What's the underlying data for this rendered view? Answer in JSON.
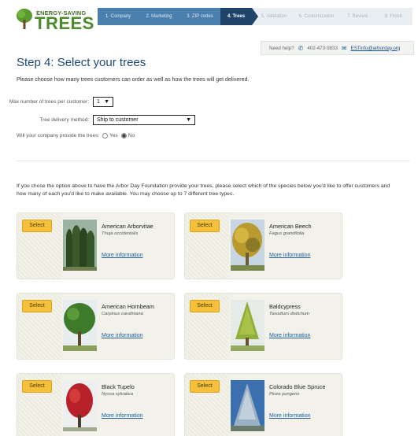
{
  "logo": {
    "small": "ENERGY-SAVING",
    "big": "TREES"
  },
  "steps": [
    {
      "label": "1. Company",
      "state": "done"
    },
    {
      "label": "2. Marketing",
      "state": "done"
    },
    {
      "label": "3. ZIP codes",
      "state": "done"
    },
    {
      "label": "4. Trees",
      "state": "active"
    },
    {
      "label": "5. Validation",
      "state": "todo"
    },
    {
      "label": "6. Customization",
      "state": "todo"
    },
    {
      "label": "7. Review",
      "state": "todo"
    },
    {
      "label": "8. Finish",
      "state": "todo"
    }
  ],
  "help": {
    "label": "Need help?",
    "phone": "402-473-9833",
    "email": "ESTinfo@arborday.org"
  },
  "page": {
    "title": "Step 4: Select your trees",
    "intro": "Please choose how many trees customers can order as well as how the trees will get delivered."
  },
  "form": {
    "max_trees_label": "Max number of trees per customer:",
    "max_trees_value": "1",
    "delivery_label": "Tree delivery method:",
    "delivery_value": "Ship to customer",
    "provide_label": "Will your company provide the trees:",
    "yes_label": "Yes",
    "no_label": "No",
    "provide_selected": "No"
  },
  "species": {
    "intro": "If you chose the option above to have the Arbor Day Foundation provide your trees, please select which of the species below you'd like to offer customers and how many of each you'd like to make available. You may choose up to 7 different tree types.",
    "select_label": "Select",
    "more_label": "More information",
    "items": [
      {
        "name": "American Arborvitae",
        "latin": "Thuja occidentalis",
        "icon": "arborvitae-photo"
      },
      {
        "name": "American Beech",
        "latin": "Fagus grandifolia",
        "icon": "beech-photo"
      },
      {
        "name": "American Hornbeam",
        "latin": "Carpinus caroliniana",
        "icon": "hornbeam-photo"
      },
      {
        "name": "Baldcypress",
        "latin": "Taxodium distichum",
        "icon": "baldcypress-photo"
      },
      {
        "name": "Black Tupelo",
        "latin": "Nyssa sylvatica",
        "icon": "tupelo-photo"
      },
      {
        "name": "Colorado Blue Spruce",
        "latin": "Picea pungens",
        "icon": "spruce-photo"
      }
    ]
  },
  "colors": {
    "brand_green": "#4d8a2b",
    "nav_active": "#20446a",
    "nav_done": "#4a7fae",
    "select_button": "#f6c03a",
    "link": "#1f5c9a"
  }
}
